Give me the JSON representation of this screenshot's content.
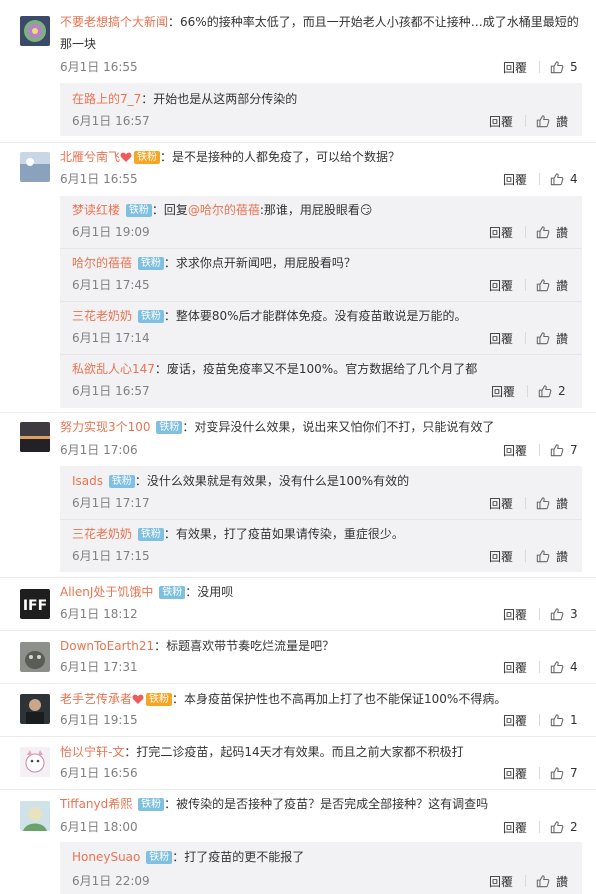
{
  "reply_label": "回覆",
  "like_placeholder": "讚",
  "comments": [
    {
      "user": "不要老想搞个大新闻",
      "text": "：66%的接种率太低了，而且一开始老人小孩都不让接种…成了水桶里最短的",
      "text2": "那一块",
      "date": "6月1日 16:55",
      "likes": "5",
      "replies": [
        {
          "user": "在路上的7_7",
          "text": "：开始也是从这两部分传染的",
          "date": "6月1日 16:57",
          "likes": ""
        }
      ]
    },
    {
      "user": "北雁兮南飞",
      "badge": "铁粉",
      "text": "：是不是接种的人都免疫了，可以给个数据？",
      "date": "6月1日 16:55",
      "likes": "4",
      "replies": [
        {
          "user": "梦读红楼",
          "badge": "铁粉",
          "text": "：回复",
          "mention": "@哈尔的蓓蓓",
          "text_after": ":那谁，用屁股眼看",
          "emoji": "😏",
          "date": "6月1日 19:09",
          "likes": ""
        },
        {
          "user": "哈尔的蓓蓓",
          "badge": "铁粉",
          "text": "：求求你点开新闻吧，用屁股看吗？",
          "date": "6月1日 17:45",
          "likes": ""
        },
        {
          "user": "三花老奶奶",
          "badge": "铁粉",
          "text": "：整体要80%后才能群体免疫。没有疫苗敢说是万能的。",
          "date": "6月1日 17:14",
          "likes": ""
        },
        {
          "user": "私欲乱人心147",
          "text": "：废话，疫苗免疫率又不是100%。官方数据给了几个月了都",
          "date": "6月1日 16:57",
          "likes": "2"
        }
      ]
    },
    {
      "user": "努力实现3个100",
      "badge": "铁粉",
      "text": "：对变异没什么效果，说出来又怕你们不打，只能说有效了",
      "date": "6月1日 17:06",
      "likes": "7",
      "replies": [
        {
          "user": "Isads",
          "badge": "铁粉",
          "text": "：没什么效果就是有效果，没有什么是100%有效的",
          "date": "6月1日 17:17",
          "likes": ""
        },
        {
          "user": "三花老奶奶",
          "badge": "铁粉",
          "text": "：有效果，打了疫苗如果请传染，重症很少。",
          "date": "6月1日 17:15",
          "likes": ""
        }
      ]
    },
    {
      "user": "AllenJ处于饥饿中",
      "badge": "铁粉",
      "text": "：没用呗",
      "date": "6月1日 18:12",
      "likes": "3",
      "replies": []
    },
    {
      "user": "DownToEarth21",
      "text": "：标题喜欢带节奏吃烂流量是吧？",
      "date": "6月1日 17:31",
      "likes": "4",
      "replies": []
    },
    {
      "user": "老手艺传承者",
      "badge": "铁粉",
      "text": "：本身疫苗保护性也不高再加上打了也不能保证100%不得病。",
      "date": "6月1日 19:15",
      "likes": "1",
      "replies": []
    },
    {
      "user": "怡以宁轩-文",
      "text": "：打完二诊疫苗，起码14天才有效果。而且之前大家都不积极打",
      "date": "6月1日 16:56",
      "likes": "7",
      "replies": []
    },
    {
      "user": "Tiffanyd希熙",
      "badge": "铁粉",
      "text": "：被传染的是否接种了疫苗？是否完成全部接种？这有调查吗",
      "date": "6月1日 18:00",
      "likes": "2",
      "replies": [
        {
          "user": "HoneySuao",
          "badge": "铁粉",
          "text": "：打了疫苗的更不能报了",
          "date": "6月1日 22:09",
          "likes": ""
        }
      ]
    }
  ]
}
